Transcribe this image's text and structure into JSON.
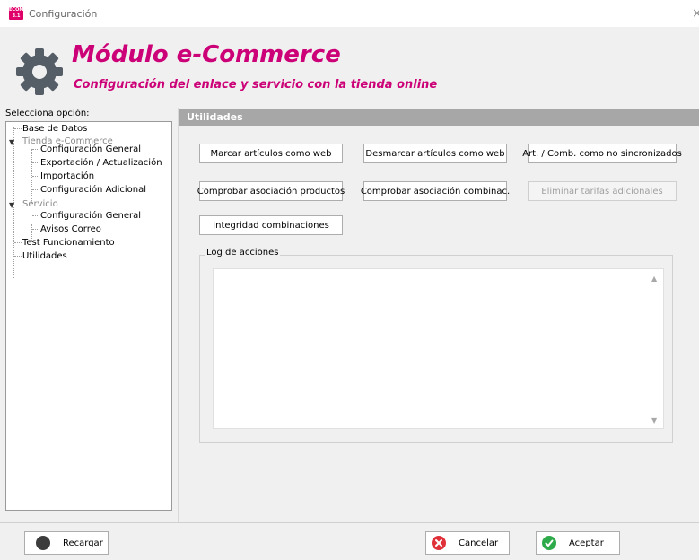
{
  "window": {
    "title": "Configuración",
    "close": "×",
    "app_icon_text": "ECOM 3.1"
  },
  "header": {
    "title": "Módulo e-Commerce",
    "subtitle": "Configuración del enlace y servicio con la tienda online",
    "accent_color": "#cc0077",
    "icon": "gear-icon"
  },
  "sidebar": {
    "label": "Selecciona opción:",
    "tree": [
      {
        "label": "Base de Datos",
        "level": 0,
        "dim": false
      },
      {
        "label": "Tienda e-Commerce",
        "level": 0,
        "dim": true,
        "expanded": true
      },
      {
        "label": "Configuración General",
        "level": 1
      },
      {
        "label": "Exportación / Actualización",
        "level": 1
      },
      {
        "label": "Importación",
        "level": 1
      },
      {
        "label": "Configuración Adicional",
        "level": 1
      },
      {
        "label": "Servicio",
        "level": 0,
        "dim": true,
        "expanded": true
      },
      {
        "label": "Configuración General",
        "level": 1
      },
      {
        "label": "Avisos Correo",
        "level": 1
      },
      {
        "label": "Test Funcionamiento",
        "level": 0,
        "dim": false
      },
      {
        "label": "Utilidades",
        "level": 0,
        "dim": false
      }
    ]
  },
  "panel": {
    "title": "Utilidades",
    "buttons": {
      "mark_web": "Marcar artículos como web",
      "unmark_web": "Desmarcar artículos como web",
      "not_synced": "Art. / Comb. como no sincronizados",
      "check_products": "Comprobar asociación productos",
      "check_combinations": "Comprobar asociación combinac.",
      "delete_rates": "Eliminar tarifas adicionales",
      "integrity": "Integridad combinaciones"
    },
    "log_label": "Log de acciones",
    "log_text": ""
  },
  "footer": {
    "reload": "Recargar",
    "cancel": "Cancelar",
    "accept": "Aceptar",
    "cancel_color": "#e0303a",
    "accept_color": "#2eaa4a"
  }
}
